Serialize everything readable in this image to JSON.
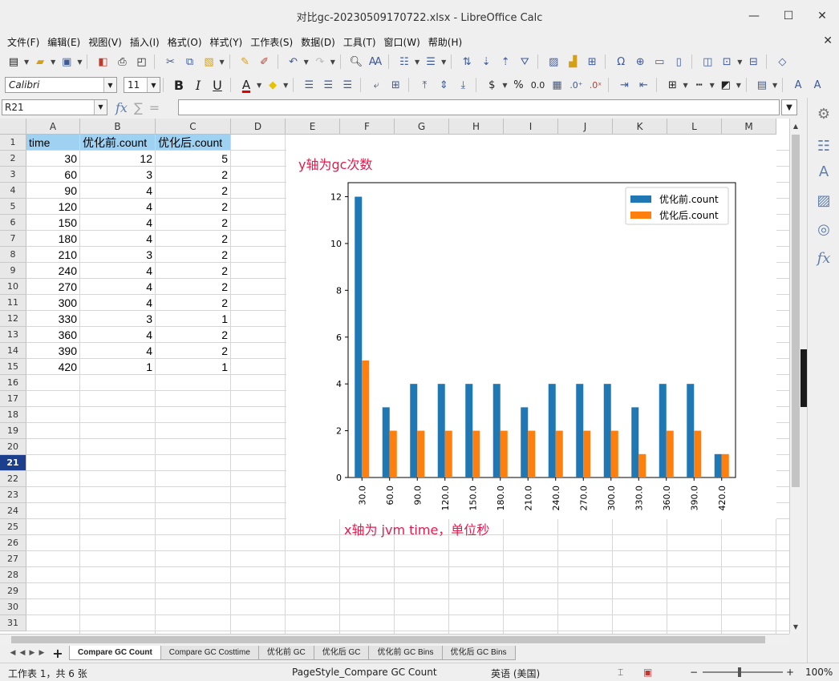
{
  "window": {
    "title": "对比gc-20230509170722.xlsx - LibreOffice Calc"
  },
  "menu": [
    "文件(F)",
    "编辑(E)",
    "视图(V)",
    "插入(I)",
    "格式(O)",
    "样式(Y)",
    "工作表(S)",
    "数据(D)",
    "工具(T)",
    "窗口(W)",
    "帮助(H)"
  ],
  "format_bar": {
    "font_name": "Calibri",
    "font_size": "11"
  },
  "formula_bar": {
    "name_box": "R21",
    "content": ""
  },
  "columns": [
    "A",
    "B",
    "C",
    "D",
    "E",
    "F",
    "G",
    "H",
    "I",
    "J",
    "K",
    "L",
    "M"
  ],
  "rows": [
    "1",
    "2",
    "3",
    "4",
    "5",
    "6",
    "7",
    "8",
    "9",
    "10",
    "11",
    "12",
    "13",
    "14",
    "15",
    "16",
    "17",
    "18",
    "19",
    "20",
    "21",
    "22",
    "23",
    "24",
    "25",
    "26",
    "27",
    "28",
    "29",
    "30",
    "31"
  ],
  "selected_row": "21",
  "sheet": {
    "header": [
      "time",
      "优化前.count",
      "优化后.count"
    ],
    "data": [
      [
        "30",
        "12",
        "5"
      ],
      [
        "60",
        "3",
        "2"
      ],
      [
        "90",
        "4",
        "2"
      ],
      [
        "120",
        "4",
        "2"
      ],
      [
        "150",
        "4",
        "2"
      ],
      [
        "180",
        "4",
        "2"
      ],
      [
        "210",
        "3",
        "2"
      ],
      [
        "240",
        "4",
        "2"
      ],
      [
        "270",
        "4",
        "2"
      ],
      [
        "300",
        "4",
        "2"
      ],
      [
        "330",
        "3",
        "1"
      ],
      [
        "360",
        "4",
        "2"
      ],
      [
        "390",
        "4",
        "2"
      ],
      [
        "420",
        "1",
        "1"
      ]
    ]
  },
  "annotations": {
    "y_note": "y轴为gc次数",
    "x_note": "x轴为 jvm time，单位秒"
  },
  "chart_data": {
    "type": "bar",
    "categories": [
      "30.0",
      "60.0",
      "90.0",
      "120.0",
      "150.0",
      "180.0",
      "210.0",
      "240.0",
      "270.0",
      "300.0",
      "330.0",
      "360.0",
      "390.0",
      "420.0"
    ],
    "series": [
      {
        "name": "优化前.count",
        "color": "#1f77b4",
        "values": [
          12,
          3,
          4,
          4,
          4,
          4,
          3,
          4,
          4,
          4,
          3,
          4,
          4,
          1
        ]
      },
      {
        "name": "优化后.count",
        "color": "#ff7f0e",
        "values": [
          5,
          2,
          2,
          2,
          2,
          2,
          2,
          2,
          2,
          2,
          1,
          2,
          2,
          1
        ]
      }
    ],
    "yticks": [
      "0",
      "2",
      "4",
      "6",
      "8",
      "10",
      "12"
    ],
    "ylim": [
      0,
      12.6
    ],
    "legend": "top-right",
    "grid": false
  },
  "sheet_tabs": [
    "Compare GC Count",
    "Compare GC Costtime",
    "优化前 GC",
    "优化后 GC",
    "优化前 GC Bins",
    "优化后 GC Bins"
  ],
  "active_tab": "Compare GC Count",
  "status": {
    "sheet_info": "工作表 1，共 6 张",
    "page_style": "PageStyle_Compare GC Count",
    "language": "英语 (美国)",
    "zoom": "100%"
  },
  "icons": {
    "minimize": "minimize-icon",
    "maximize": "maximize-icon",
    "close": "close-icon"
  }
}
